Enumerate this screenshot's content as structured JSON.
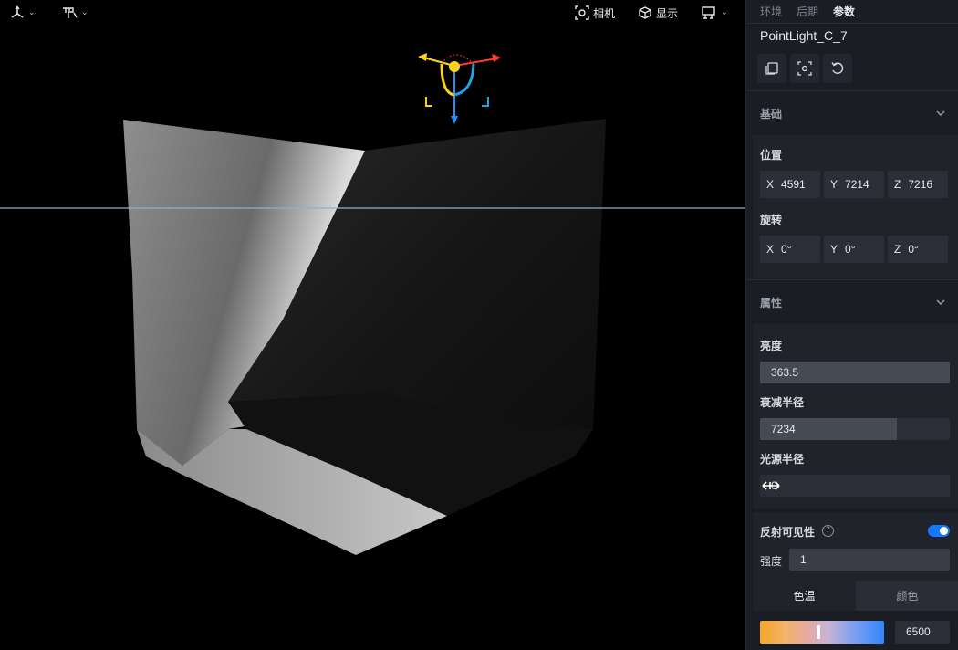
{
  "toolbar": {
    "camera_label": "相机",
    "display_label": "显示"
  },
  "panel": {
    "tabs": [
      {
        "label": "环境",
        "active": false
      },
      {
        "label": "后期",
        "active": false
      },
      {
        "label": "参数",
        "active": true
      }
    ],
    "object_name": "PointLight_C_7",
    "basic": {
      "title": "基础",
      "position_label": "位置",
      "position": {
        "x": "4591",
        "y": "7214",
        "z": "7216"
      },
      "rotation_label": "旋转",
      "rotation": {
        "x": "0°",
        "y": "0°",
        "z": "0°"
      },
      "axis_labels": {
        "x": "X",
        "y": "Y",
        "z": "Z"
      }
    },
    "attributes": {
      "title": "属性",
      "brightness_label": "亮度",
      "brightness": "363.5",
      "brightness_fill": 1.0,
      "attenuation_label": "衰减半径",
      "attenuation": "7234",
      "attenuation_fill": 0.72,
      "source_radius_label": "光源半径",
      "source_radius": "0",
      "source_radius_fill": 0.0,
      "reflection_label": "反射可见性",
      "reflection_enabled": true,
      "intensity_label": "强度",
      "intensity": "1",
      "color_tabs": [
        {
          "label": "色温",
          "active": true
        },
        {
          "label": "颜色",
          "active": false
        }
      ],
      "color_temperature": "6500"
    }
  },
  "colors": {
    "accent": "#1677ff",
    "panel_bg": "#1a1d23",
    "gizmo_x": "#ff3b2f",
    "gizmo_y": "#ffd21f",
    "gizmo_z": "#1e90ff"
  }
}
